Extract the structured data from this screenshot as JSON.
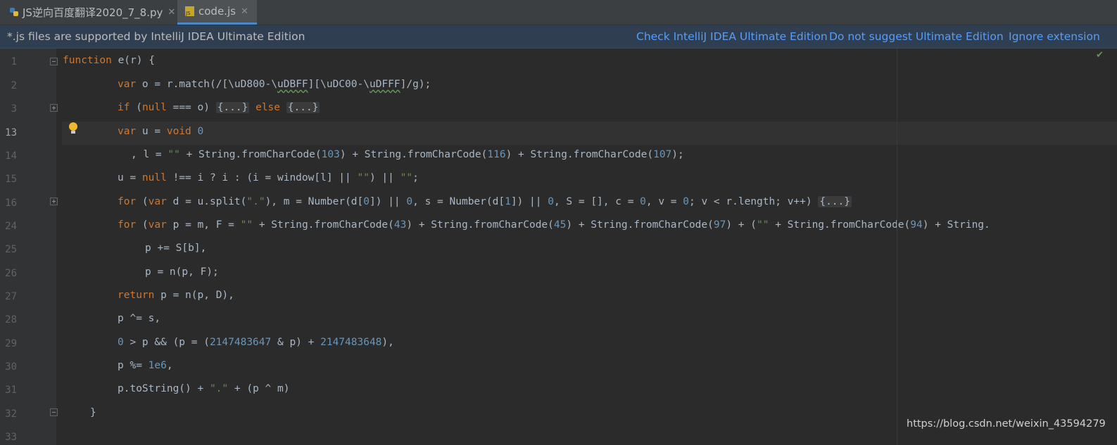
{
  "tabs": [
    {
      "label": "JS逆向百度翻译2020_7_8.py",
      "active": false,
      "icon": "python-file-icon"
    },
    {
      "label": "code.js",
      "active": true,
      "icon": "js-file-icon"
    }
  ],
  "banner": {
    "message": "*.js files are supported by IntelliJ IDEA Ultimate Edition",
    "links": [
      "Check IntelliJ IDEA Ultimate Edition",
      "Do not suggest Ultimate Edition",
      "Ignore extension"
    ]
  },
  "editor": {
    "line_numbers": [
      "1",
      "2",
      "3",
      "13",
      "14",
      "15",
      "16",
      "24",
      "25",
      "26",
      "27",
      "28",
      "29",
      "30",
      "31",
      "32",
      "33"
    ],
    "current_line": "13",
    "watermark": "https://blog.csdn.net/weixin_43594279"
  },
  "colors": {
    "keyword": "#cc7832",
    "number": "#6897bb",
    "string": "#6a8759",
    "text": "#a9b7c6",
    "link": "#589df6"
  }
}
